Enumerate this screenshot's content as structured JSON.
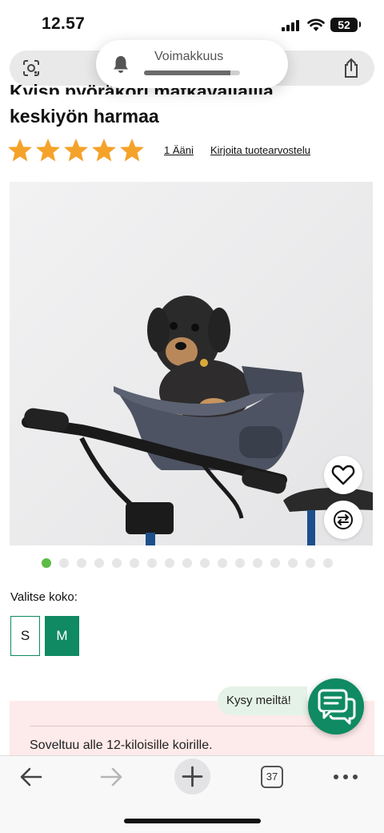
{
  "status_bar": {
    "time": "12.57",
    "battery": "52"
  },
  "volume_hud": {
    "label": "Voimakkuus",
    "level": 0.9
  },
  "product": {
    "title_line1": "Kvisp pyöräkori matkavaljailla",
    "title_line2": "keskiyön harmaa",
    "rating_stars": 5,
    "votes_text": "1 Ääni",
    "review_text": "Kirjoita tuotearvostelu"
  },
  "gallery": {
    "dot_count": 17,
    "active_index": 0
  },
  "size_selector": {
    "label": "Valitse koko:",
    "options": [
      "S",
      "M"
    ],
    "selected": "M"
  },
  "info": {
    "text": "Soveltuu alle 12-kiloisille koirille."
  },
  "chat": {
    "label": "Kysy meiltä!"
  },
  "bottom_bar": {
    "tab_count": "37"
  },
  "colors": {
    "accent": "#0f8a62",
    "star": "#f5a22a",
    "dot_active": "#5dbb46",
    "info_bg": "#fdeaea"
  }
}
